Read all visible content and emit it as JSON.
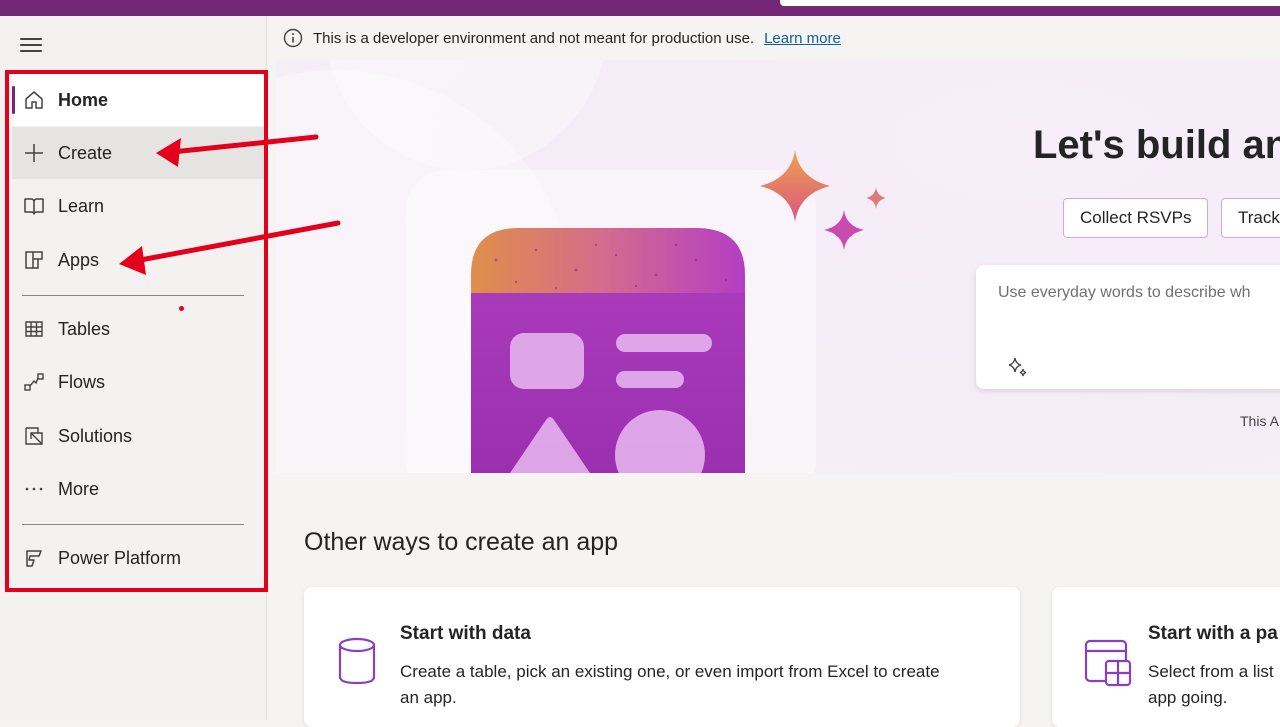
{
  "banner": {
    "message": "This is a developer environment and not meant for production use.",
    "link": "Learn more"
  },
  "nav": {
    "items": [
      {
        "label": "Home",
        "icon": "home-icon"
      },
      {
        "label": "Create",
        "icon": "plus-icon"
      },
      {
        "label": "Learn",
        "icon": "book-icon"
      },
      {
        "label": "Apps",
        "icon": "apps-icon"
      },
      {
        "label": "Tables",
        "icon": "table-icon"
      },
      {
        "label": "Flows",
        "icon": "flow-icon"
      },
      {
        "label": "Solutions",
        "icon": "solutions-icon"
      },
      {
        "label": "More",
        "icon": "more-icon"
      },
      {
        "label": "Power Platform",
        "icon": "power-platform-icon"
      }
    ]
  },
  "hero": {
    "title": "Let's build an",
    "chips": [
      "Collect RSVPs",
      "Track"
    ],
    "prompt_placeholder": "Use everyday words to describe wh",
    "disclaimer": "This A"
  },
  "section": {
    "title": "Other ways to create an app",
    "cards": [
      {
        "title": "Start with data",
        "desc": "Create a table, pick an existing one, or even import from Excel to create an app.",
        "icon": "database-icon"
      },
      {
        "title": "Start with a pa",
        "desc": "Select from a list app going.",
        "icon": "page-template-icon"
      }
    ]
  },
  "colors": {
    "brand": "#742774",
    "annotation": "#e3001b",
    "link": "#115ea3"
  }
}
